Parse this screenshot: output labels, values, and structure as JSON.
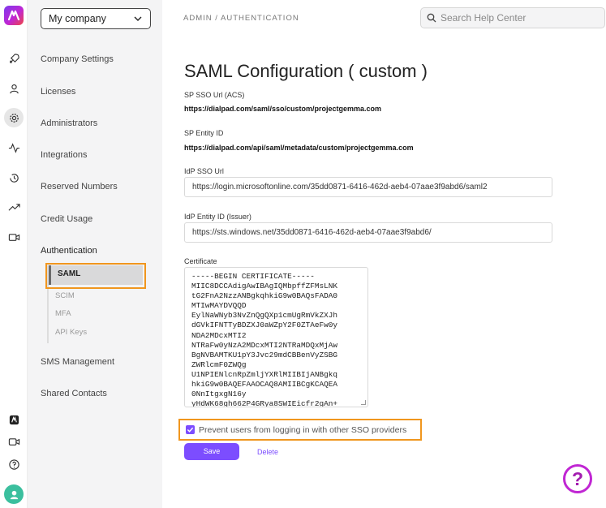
{
  "sidebar": {
    "company": "My company",
    "items": [
      {
        "label": "Company Settings"
      },
      {
        "label": "Licenses"
      },
      {
        "label": "Administrators"
      },
      {
        "label": "Integrations"
      },
      {
        "label": "Reserved Numbers"
      },
      {
        "label": "Credit Usage"
      },
      {
        "label": "Authentication"
      },
      {
        "label": "SMS Management"
      },
      {
        "label": "Shared Contacts"
      }
    ],
    "subitems": [
      "SAML",
      "SCIM",
      "MFA",
      "API Keys"
    ]
  },
  "header": {
    "breadcrumb": "ADMIN / AUTHENTICATION",
    "search_placeholder": "Search Help Center"
  },
  "main": {
    "title": "SAML Configuration ( custom )",
    "sp_sso_label": "SP SSO Url (ACS)",
    "sp_sso_value": "https://dialpad.com/saml/sso/custom/projectgemma.com",
    "sp_entity_label": "SP Entity ID",
    "sp_entity_value": "https://dialpad.com/api/saml/metadata/custom/projectgemma.com",
    "idp_sso_label": "IdP SSO Url",
    "idp_sso_value": "https://login.microsoftonline.com/35dd0871-6416-462d-aeb4-07aae3f9abd6/saml2",
    "idp_entity_label": "IdP Entity ID (Issuer)",
    "idp_entity_value": "https://sts.windows.net/35dd0871-6416-462d-aeb4-07aae3f9abd6/",
    "cert_label": "Certificate",
    "certificate": "-----BEGIN CERTIFICATE-----\nMIIC8DCCAdigAwIBAgIQMbpffZFMsLNK\ntG2FnA2NzzANBgkqhkiG9w0BAQsFADA0\nMTIwMAYDVQQD\nEylNaWNyb3NvZnQgQXp1cmUgRmVkZXJh\ndGVkIFNTTyBDZXJ0aWZpY2F0ZTAeFw0y\nNDA2MDcxMTI2\nNTRaFw0yNzA2MDcxMTI2NTRaMDQxMjAw\nBgNVBAMTKU1pY3Jvc29mdCBBenVyZSBG\nZWRlcmF0ZWQg\nU1NPIENlcnRpZmljYXRlMIIBIjANBgkq\nhkiG9w0BAQEFAAOCAQ8AMIIBCgKCAQEA\n0NnItgxgN16y\nyHdWK68gh662P4GRya8SWIEicfr2gAn+",
    "checkbox_label": "Prevent users from logging in with other SSO providers",
    "save_label": "Save",
    "delete_label": "Delete"
  },
  "help": {
    "glyph": "?"
  },
  "colors": {
    "accent": "#7c4dff",
    "highlight": "#f0961e"
  }
}
